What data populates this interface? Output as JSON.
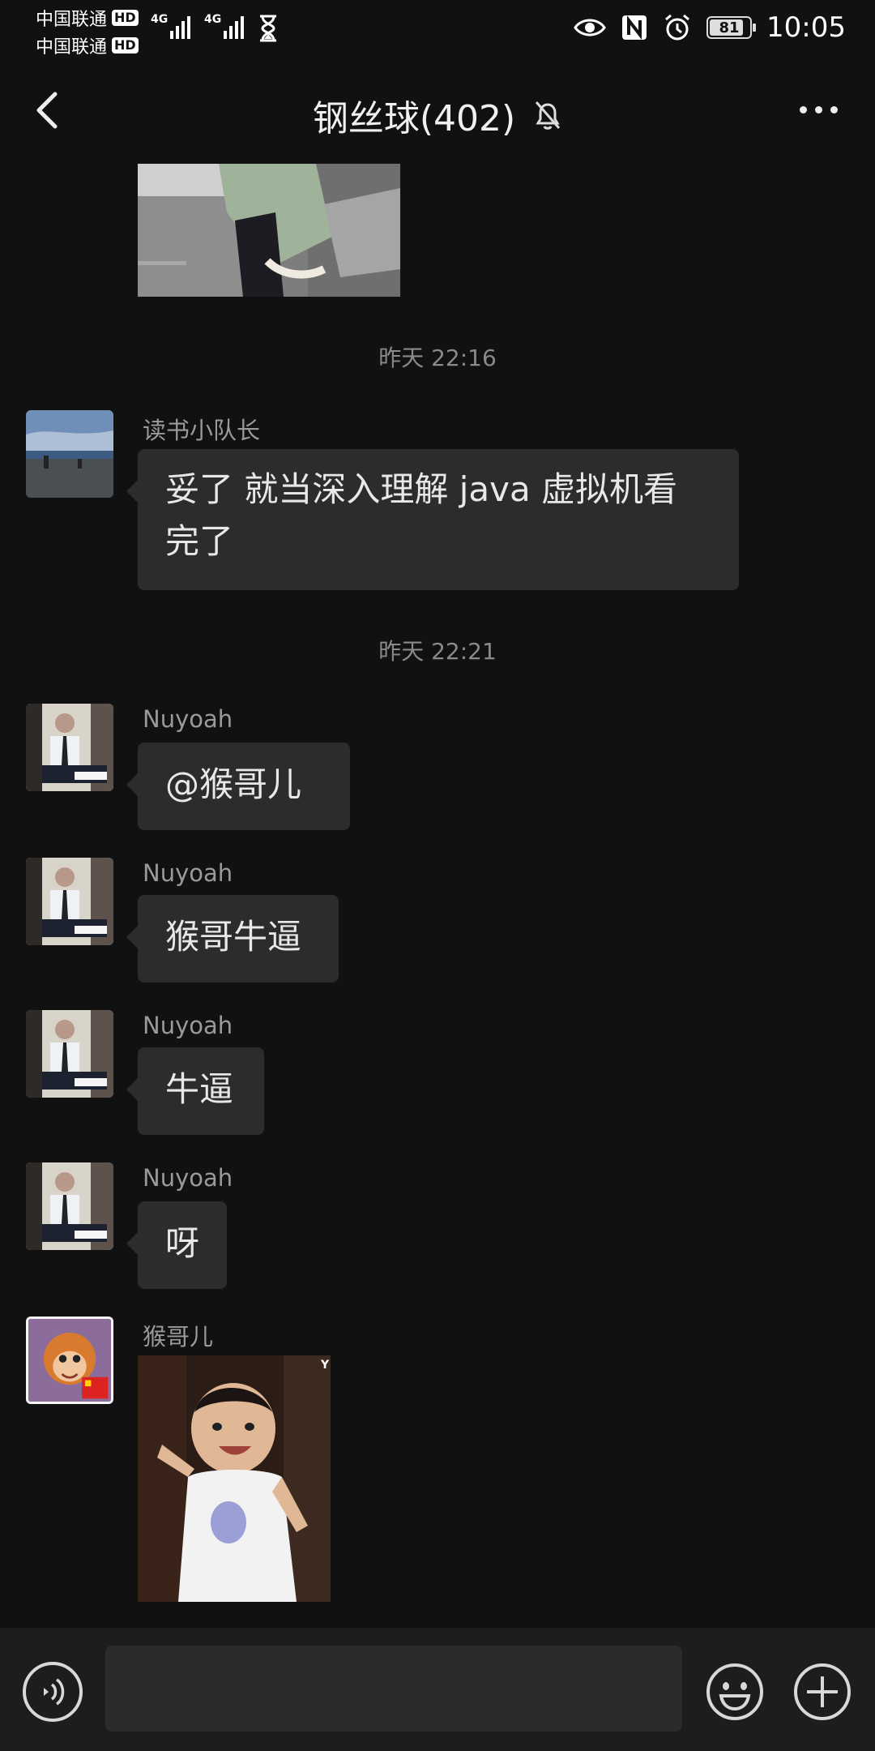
{
  "status_bar": {
    "carrier1": "中国联通",
    "carrier2": "中国联通",
    "hd": "HD",
    "network": "4G",
    "battery": "81",
    "time": "10:05"
  },
  "header": {
    "title": "钢丝球(402)"
  },
  "messages": [
    {
      "timestamp": "昨天 22:16"
    },
    {
      "sender": "读书小队长",
      "text_line1": "妥了  就当深入理解 java 虚拟机看",
      "text_line2": "完了"
    },
    {
      "timestamp": "昨天 22:21"
    },
    {
      "sender": "Nuyoah",
      "text": "@猴哥儿"
    },
    {
      "sender": "Nuyoah",
      "text": "猴哥牛逼"
    },
    {
      "sender": "Nuyoah",
      "text": "牛逼"
    },
    {
      "sender": "Nuyoah",
      "text": "呀"
    },
    {
      "sender": "猴哥儿",
      "sticker_watermark": "Y"
    }
  ],
  "input": {
    "placeholder": ""
  },
  "colors": {
    "background": "#111111",
    "bubble": "#2c2c2c",
    "input_bar": "#1d1d1d"
  }
}
